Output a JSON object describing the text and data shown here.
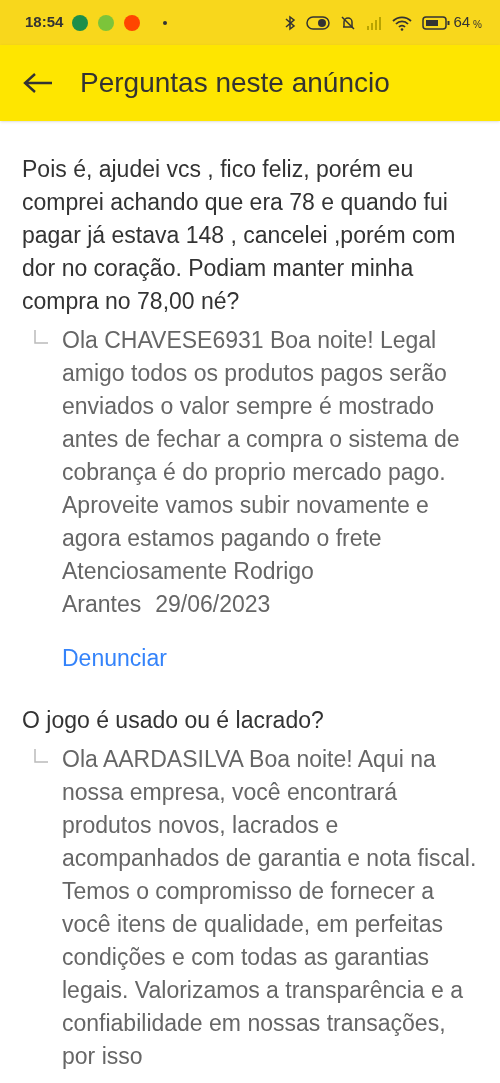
{
  "status_bar": {
    "time": "18:54",
    "battery": "64",
    "battery_unit": "%"
  },
  "header": {
    "title": "Perguntas neste anúncio"
  },
  "questions": [
    {
      "question": "Pois é, ajudei vcs , fico feliz, porém eu comprei achando que era 78 e quando fui pagar já estava 148 , cancelei ,porém com dor no coração. Podiam manter minha compra no 78,00 né?",
      "answer": "Ola CHAVESE6931 Boa noite! Legal amigo todos os produtos pagos serão enviados o valor sempre é mostrado antes de fechar a compra o sistema de cobrança é do proprio mercado pago. Aproveite vamos subir novamente e agora estamos pagando o frete Atenciosamente Rodrigo Arantes",
      "date": "29/06/2023",
      "report": "Denunciar"
    },
    {
      "question": "O jogo é usado ou é lacrado?",
      "answer": "Ola AARDASILVA Boa noite! Aqui na nossa empresa, você encontrará produtos novos, lacrados e acompanhados de garantia e nota fiscal. Temos o compromisso de fornecer a você itens de qualidade, em perfeitas condições e com todas as garantias legais. Valorizamos a transparência e a confiabilidade em nossas transações, por isso"
    }
  ]
}
